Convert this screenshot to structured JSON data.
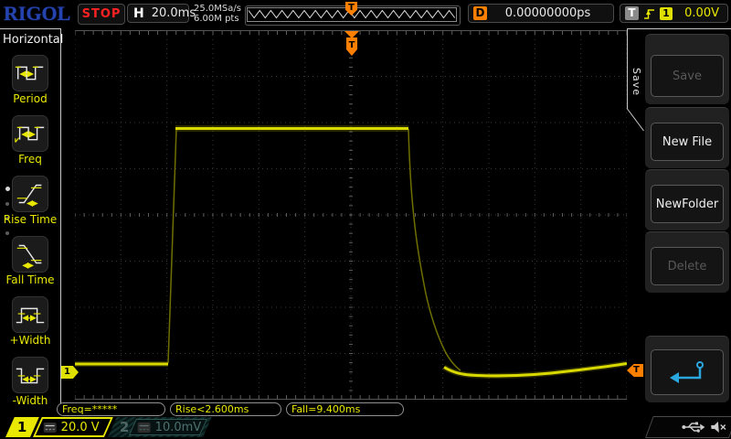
{
  "top_bar": {
    "logo": "RIGOL",
    "run_state": "STOP",
    "timebase_label": "H",
    "timebase": "20.0ms",
    "sample_rate": "25.0MSa/s",
    "memory_depth": "6.00M pts",
    "delay_label": "D",
    "delay_value": "0.00000000ps",
    "trigger_label": "T",
    "trigger_source": "1",
    "trigger_level": "0.00V"
  },
  "left_menu": {
    "title": "Horizontal",
    "items": [
      {
        "label": "Period",
        "icon": "period-icon"
      },
      {
        "label": "Freq",
        "icon": "freq-icon"
      },
      {
        "label": "Rise Time",
        "icon": "rise-time-icon"
      },
      {
        "label": "Fall Time",
        "icon": "fall-time-icon"
      },
      {
        "label": "+Width",
        "icon": "pos-width-icon"
      },
      {
        "label": "-Width",
        "icon": "neg-width-icon"
      }
    ]
  },
  "right_menu": {
    "tab_label": "Save",
    "buttons": [
      {
        "label": "Save",
        "enabled": false
      },
      {
        "label": "New File",
        "enabled": true
      },
      {
        "label": "NewFolder",
        "enabled": true
      },
      {
        "label": "Delete",
        "enabled": false
      }
    ],
    "return_button": {
      "icon": "return-arrow-icon"
    }
  },
  "measurements": {
    "freq": "Freq=*****",
    "rise": "Rise<2.600ms",
    "fall": "Fall=9.400ms"
  },
  "channels": {
    "ch1": {
      "number": "1",
      "scale": "20.0 V",
      "active": true,
      "coupling_icon": "dc-coupling-icon"
    },
    "ch2": {
      "number": "2",
      "scale": "10.0mV",
      "active": false,
      "coupling_icon": "dc-coupling-icon"
    }
  },
  "markers": {
    "trigger_position_label": "T",
    "trigger_level_label": "T",
    "channel1_marker_label": "1"
  },
  "status_icons": [
    "usb-icon",
    "speaker-muted-icon"
  ],
  "colors": {
    "trace_yellow": "#d9d900",
    "accent_orange": "#ff8000",
    "menu_label_yellow": "#e8e800",
    "logo_blue": "#2443ae",
    "stop_red": "#ff2222",
    "ch2_teal": "#2e5654"
  }
}
